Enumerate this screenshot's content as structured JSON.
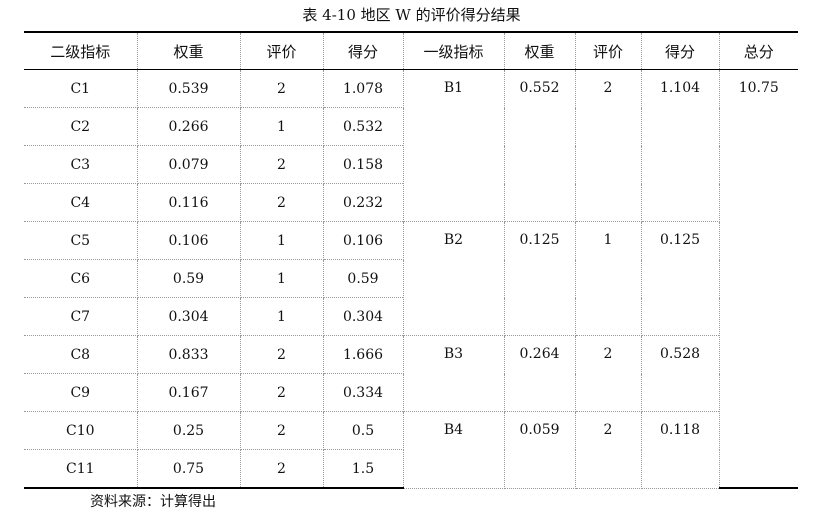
{
  "title": "表 4-10 地区 W 的评价得分结果",
  "headers": [
    "二级指标",
    "权重",
    "评价",
    "得分",
    "一级指标",
    "权重",
    "评价",
    "得分",
    "总分"
  ],
  "rows": [
    {
      "code": "C1",
      "weight": "0.539",
      "rating": "2",
      "score": "1.078"
    },
    {
      "code": "C2",
      "weight": "0.266",
      "rating": "1",
      "score": "0.532"
    },
    {
      "code": "C3",
      "weight": "0.079",
      "rating": "2",
      "score": "0.158"
    },
    {
      "code": "C4",
      "weight": "0.116",
      "rating": "2",
      "score": "0.232"
    },
    {
      "code": "C5",
      "weight": "0.106",
      "rating": "1",
      "score": "0.106"
    },
    {
      "code": "C6",
      "weight": "0.59",
      "rating": "1",
      "score": "0.59"
    },
    {
      "code": "C7",
      "weight": "0.304",
      "rating": "1",
      "score": "0.304"
    },
    {
      "code": "C8",
      "weight": "0.833",
      "rating": "2",
      "score": "1.666"
    },
    {
      "code": "C9",
      "weight": "0.167",
      "rating": "2",
      "score": "0.334"
    },
    {
      "code": "C10",
      "weight": "0.25",
      "rating": "2",
      "score": "0.5"
    },
    {
      "code": "C11",
      "weight": "0.75",
      "rating": "2",
      "score": "1.5"
    }
  ],
  "groups": [
    {
      "code": "B1",
      "weight": "0.552",
      "rating": "2",
      "score": "1.104"
    },
    {
      "code": "B2",
      "weight": "0.125",
      "rating": "1",
      "score": "0.125"
    },
    {
      "code": "B3",
      "weight": "0.264",
      "rating": "2",
      "score": "0.528"
    },
    {
      "code": "B4",
      "weight": "0.059",
      "rating": "2",
      "score": "0.118"
    }
  ],
  "total": "10.75",
  "source": "资料来源：计算得出"
}
